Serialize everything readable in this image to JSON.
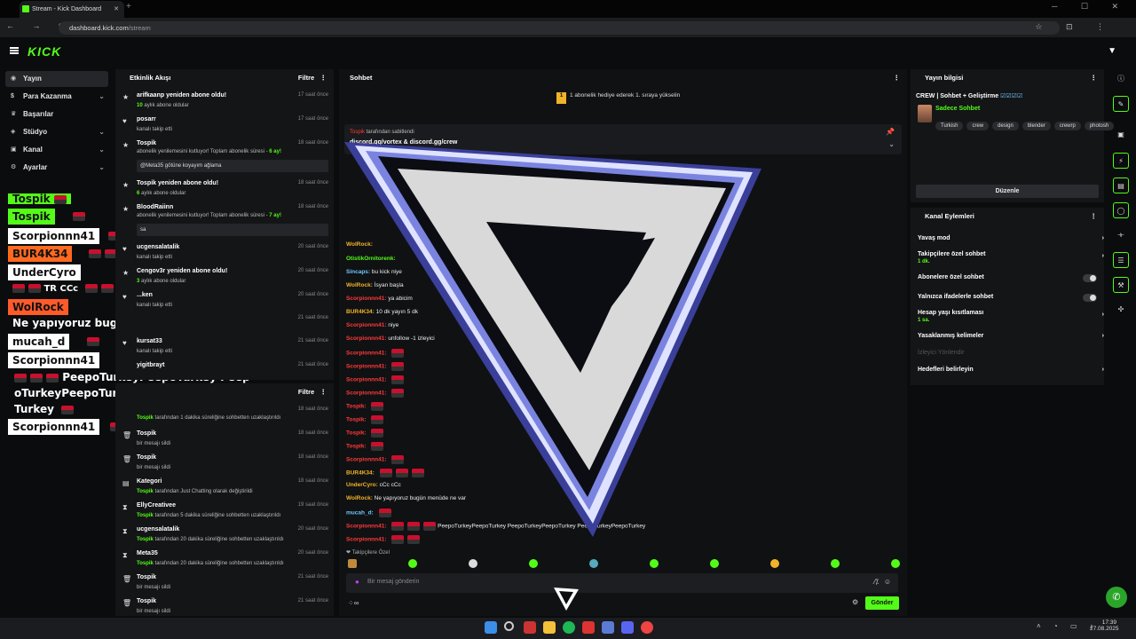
{
  "browser": {
    "tab_title": "Stream - Kick Dashboard",
    "tab_close": "✕",
    "new_tab": "+",
    "url_domain": "dashboard.kick.com",
    "url_path": "/stream",
    "window_controls": "─ ☐ ✕",
    "nav_buttons": "← → ⟳",
    "toolbar_icons": "☆ ⊡ ⋮"
  },
  "header": {
    "logo": "KICK",
    "top_right_icon": "▼"
  },
  "sidebar": {
    "items": [
      {
        "label": "Yayın",
        "icon": "broadcast-icon"
      },
      {
        "label": "Para Kazanma",
        "icon": "money-icon"
      },
      {
        "label": "Başarılar",
        "icon": "trophy-icon"
      },
      {
        "label": "Stüdyo",
        "icon": "studio-icon"
      },
      {
        "label": "Kanal",
        "icon": "channel-icon"
      },
      {
        "label": "Ayarlar",
        "icon": "gear-icon"
      }
    ]
  },
  "overlay_chat": [
    {
      "text": "Tospik"
    },
    {
      "text": "Tospik"
    },
    {
      "text": "Scorpionnn41"
    },
    {
      "text": "BUR4K34"
    },
    {
      "text": "UnderCyro"
    },
    {
      "text": "TR CCc",
      "prefix": "TR"
    },
    {
      "text": "WolRock"
    },
    {
      "text": "Ne yapıyoruz bugün menüde ne var"
    },
    {
      "text": "mucah_d"
    },
    {
      "text": "Scorpionnn41"
    },
    {
      "text": "PeepoTurkeyPeepoTurkey Peep"
    },
    {
      "text": "oTurkeyPeepoTurkey PeepoTurkeyPeepo"
    },
    {
      "text": "Turkey"
    },
    {
      "text": "Scorpionnn41"
    }
  ],
  "activity": {
    "title": "Etkinlik Akışı",
    "filter": "Filtre",
    "items": [
      {
        "title": "arifkaanp yeniden abone oldu!",
        "sub_b": "10",
        "sub": " aylık abone oldular",
        "time": "17 saat önce"
      },
      {
        "title": "posarr",
        "sub": "kanalı takip etti",
        "time": "17 saat önce"
      },
      {
        "title": "Tospik",
        "sub": "abonelik yenilemesini kutluyor! Toplam abonelik süresi - ",
        "sub_b": "6 ay!",
        "time": "18 saat önce",
        "box": "@Meta35 götüne koyayım ağlama"
      },
      {
        "title": "Tospik yeniden abone oldu!",
        "sub_b": "6",
        "sub": " aylık abone oldular",
        "time": "18 saat önce"
      },
      {
        "title": "BloodRaiinn",
        "sub": "abonelik yenilemesini kutluyor! Toplam abonelik süresi - ",
        "sub_b": "7 ay!",
        "time": "18 saat önce",
        "box": "sa"
      },
      {
        "title": "ucgensalatalik",
        "sub": "kanalı takip etti",
        "time": "20 saat önce"
      },
      {
        "title": "Cengov3r yeniden abone oldu!",
        "sub_b": "3",
        "sub": " aylık abone oldular",
        "time": "20 saat önce"
      },
      {
        "title": "...ken",
        "sub": "kanalı takip etti",
        "time": "20 saat önce"
      },
      {
        "title": "",
        "sub": "",
        "time": "21 saat önce"
      },
      {
        "title": "kursat33",
        "sub": "kanalı takip etti",
        "time": "21 saat önce"
      },
      {
        "title": "yigitbrayt",
        "sub": "",
        "time": "21 saat önce"
      }
    ]
  },
  "moderation": {
    "filter": "Filtre",
    "items": [
      {
        "title": "",
        "sub_b": "Tospik",
        "sub": " tarafından 1 dakika süreliğine sohbetten uzaklaştırıldı",
        "time": "18 saat önce"
      },
      {
        "title": "Tospik",
        "sub": "bir mesajı sildi",
        "time": "18 saat önce"
      },
      {
        "title": "Tospik",
        "sub": "bir mesajı sildi",
        "time": "18 saat önce"
      },
      {
        "title": "Kategori",
        "sub_b": "Tospik",
        "sub": " tarafından Just Chatting olarak değiştirildi",
        "time": "18 saat önce"
      },
      {
        "title": "EllyCreativee",
        "sub_b": "Tospik",
        "sub": " tarafından 5 dakika süreliğine sohbetten uzaklaştırıldı",
        "time": "19 saat önce"
      },
      {
        "title": "ucgensalatalik",
        "sub_b": "Tospik",
        "sub": " tarafından 20 dakika süreliğine sohbetten uzaklaştırıldı",
        "time": "20 saat önce"
      },
      {
        "title": "Meta35",
        "sub_b": "Tospik",
        "sub": " tarafından 20 dakika süreliğine sohbetten uzaklaştırıldı",
        "time": "20 saat önce"
      },
      {
        "title": "Tospik",
        "sub": "bir mesajı sildi",
        "time": "21 saat önce"
      },
      {
        "title": "Tospik",
        "sub": "bir mesajı sildi",
        "time": "21 saat önce"
      }
    ]
  },
  "chat": {
    "title": "Sohbet",
    "goal": "1 abonelik hediye ederek 1. sıraya yükselin",
    "pinned_by": "tarafından sabitlendi",
    "pinned_msg": "discord.gg/vortex & discord.gg/crew",
    "lines": [
      {
        "user": "WolRock:",
        "msg": "",
        "ucls": "yel"
      },
      {
        "user": "OtistikOrnitorenk:",
        "msg": "",
        "ucls": "grn"
      },
      {
        "user": "Sincaps:",
        "msg": "bu kick niye",
        "ucls": "cyn"
      },
      {
        "user": "WolRock:",
        "msg": "İsyan başla",
        "ucls": "yel"
      },
      {
        "user": "",
        "msg": "ya abicim",
        "ucls": "red"
      },
      {
        "user": "BUR4K34:",
        "msg": "10 dk yayın 5 dk",
        "ucls": "yel"
      },
      {
        "user": "",
        "msg": "niye",
        "ucls": "red"
      },
      {
        "user": "",
        "msg": "unfollow -1 izleyici",
        "ucls": "red"
      },
      {
        "user": "Tospik:",
        "msg": "",
        "ucls": "red"
      },
      {
        "user": "BUR4K34:",
        "msg": "",
        "ucls": "yel"
      },
      {
        "user": "UnderCyro:",
        "msg": "cCc  cCc",
        "ucls": "yel"
      },
      {
        "user": "WolRock:",
        "msg": "Ne yapıyoruz bugün menüde ne var",
        "ucls": "yel"
      },
      {
        "user": "mucah_d:",
        "msg": "",
        "ucls": "cyn"
      },
      {
        "user": "",
        "msg": "PeepoTurkeyPeepoTurkey PeepoTurkeyPeepoTurkey PeepoTurkeyPeepoTurkey",
        "ucls": "red"
      }
    ],
    "subs_only": "Takipçilere Özel",
    "placeholder": "Bir mesaj gönderin",
    "send": "Gönder"
  },
  "stream_info": {
    "title": "Yayın bilgisi",
    "stream_title": "CREW | Sohbet + Geliştirme",
    "category": "Sadece Sohbet",
    "tags": [
      "Turkish",
      "crew",
      "design",
      "blender",
      "crewrp",
      "photosh"
    ],
    "edit": "Düzenle"
  },
  "channel_actions": {
    "title": "Kanal Eylemleri",
    "items": [
      {
        "label": "Yavaş mod",
        "sub": "",
        "control": "chevron"
      },
      {
        "label": "Takipçilere özel sohbet",
        "sub": "1 dk.",
        "control": "chevron"
      },
      {
        "label": "Abonelere özel sohbet",
        "sub": "",
        "control": "toggle"
      },
      {
        "label": "Yalnızca ifadelerle sohbet",
        "sub": "",
        "control": "toggle"
      },
      {
        "label": "Hesap yaşı kısıtlaması",
        "sub": "1 sa.",
        "control": "chevron"
      },
      {
        "label": "Yasaklanmış kelimeler",
        "sub": "",
        "control": "chevron"
      },
      {
        "label": "İzleyici Yönlendir",
        "sub": "",
        "control": "none"
      },
      {
        "label": "Hedefleri belirleyin",
        "sub": "",
        "control": "chevron"
      }
    ]
  },
  "clock": {
    "time": "17:39",
    "date": "27.08.2025"
  },
  "colors": {
    "brand": "#53fc18",
    "bg": "#0b0c0d",
    "panel": "#141517"
  }
}
